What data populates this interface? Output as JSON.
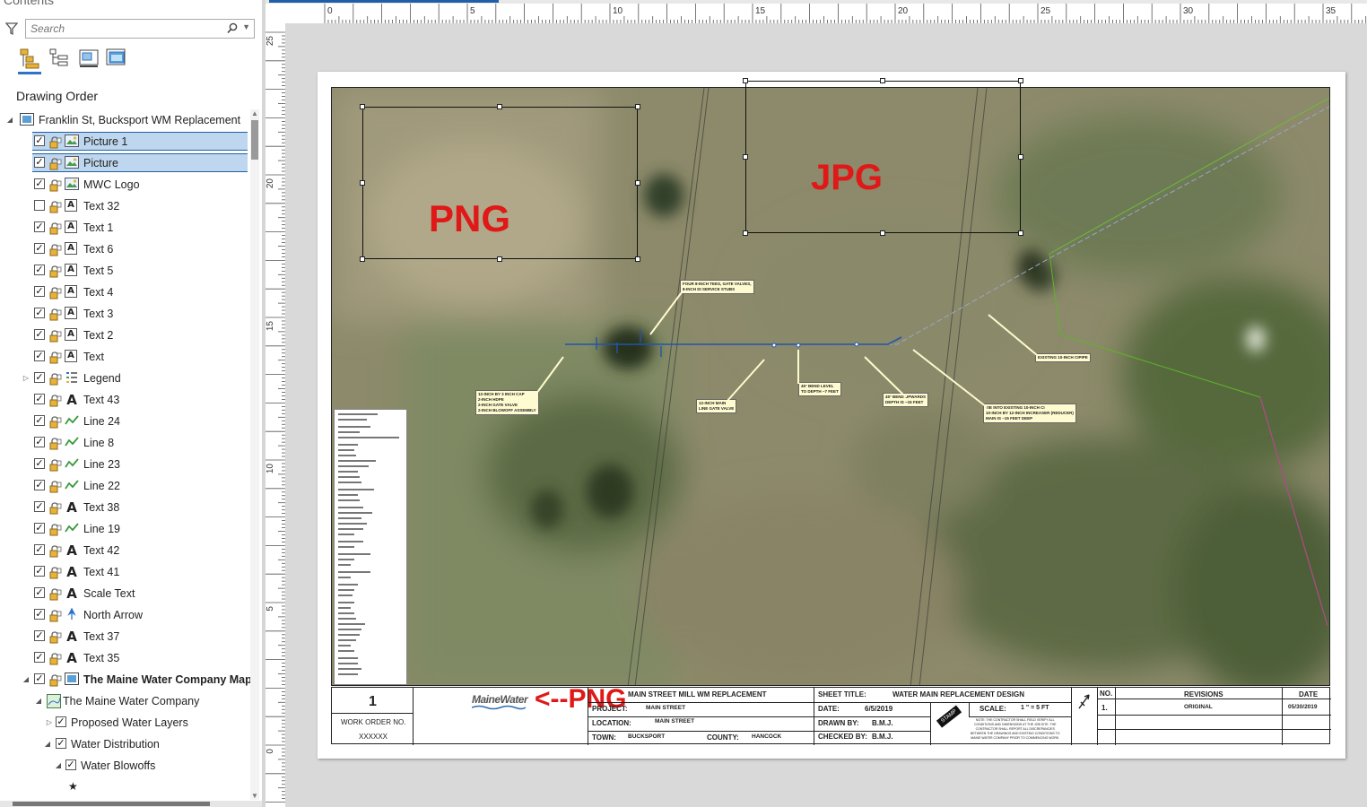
{
  "contents": {
    "pane_title": "Contents",
    "search_placeholder": "Search",
    "section_title": "Drawing Order",
    "map_name": "Franklin St, Bucksport WM Replacement",
    "items": [
      {
        "label": "Picture 1",
        "icon": "picture-icon",
        "checked": true
      },
      {
        "label": "Picture",
        "icon": "picture-icon",
        "checked": true
      },
      {
        "label": "MWC Logo",
        "icon": "picture-icon",
        "checked": true
      },
      {
        "label": "Text 32",
        "icon": "text-icon",
        "checked": false
      },
      {
        "label": "Text 1",
        "icon": "text-icon",
        "checked": true
      },
      {
        "label": "Text 6",
        "icon": "text-icon",
        "checked": true
      },
      {
        "label": "Text 5",
        "icon": "text-icon",
        "checked": true
      },
      {
        "label": "Text 4",
        "icon": "text-icon",
        "checked": true
      },
      {
        "label": "Text 3",
        "icon": "text-icon",
        "checked": true
      },
      {
        "label": "Text 2",
        "icon": "text-icon",
        "checked": true
      },
      {
        "label": "Text",
        "icon": "text-icon",
        "checked": true
      },
      {
        "label": "Legend",
        "icon": "legend-icon",
        "checked": true
      },
      {
        "label": "Text 43",
        "icon": "text-icon",
        "checked": true
      },
      {
        "label": "Line 24",
        "icon": "line-icon",
        "checked": true
      },
      {
        "label": "Line 8",
        "icon": "line-icon",
        "checked": true
      },
      {
        "label": "Line 23",
        "icon": "line-icon",
        "checked": true
      },
      {
        "label": "Line 22",
        "icon": "line-icon",
        "checked": true
      },
      {
        "label": "Text 38",
        "icon": "text-icon",
        "checked": true
      },
      {
        "label": "Line 19",
        "icon": "line-icon",
        "checked": true
      },
      {
        "label": "Text 42",
        "icon": "text-icon",
        "checked": true
      },
      {
        "label": "Text 41",
        "icon": "text-icon",
        "checked": true
      },
      {
        "label": "Scale Text",
        "icon": "text-icon",
        "checked": true
      },
      {
        "label": "North Arrow",
        "icon": "north-arrow-icon",
        "checked": true
      },
      {
        "label": "Text 37",
        "icon": "text-icon",
        "checked": true
      },
      {
        "label": "Text 35",
        "icon": "text-icon",
        "checked": true
      },
      {
        "label": "The Maine Water Company Map I",
        "icon": "map-frame-icon",
        "checked": true
      },
      {
        "label": "The Maine Water Company",
        "icon": "map-icon"
      },
      {
        "label": "Proposed Water Layers",
        "checked": true
      },
      {
        "label": "Water Distribution",
        "checked": true
      },
      {
        "label": "Water Blowoffs",
        "checked": true
      }
    ]
  },
  "ruler": {
    "h_labels": [
      "0",
      "5",
      "10",
      "15",
      "20",
      "25",
      "30",
      "35"
    ],
    "v_labels": [
      "25",
      "20",
      "15",
      "10",
      "5",
      "0"
    ]
  },
  "overlays": {
    "png_label": "PNG",
    "jpg_label": "JPG",
    "png_arrow_label": "<--PNG"
  },
  "annotations": {
    "a1": "FOUR 8-INCH TEES, GATE VALVES,\n8-INCH DI SERVICE STUBS",
    "a2": "12-INCH BY 3 INCH CAP\n2-INCH HDPE\n2-INCH GATE VALVE\n2-INCH BLOWOFF ASSEMBLY",
    "a3": "12-INCH MAIN\nLINE GATE VALVE",
    "a4": "45° BEND LEVEL\nTO DEPTH ~7 FEET",
    "a5": "45° BEND UPWARDS\nDEPTH IS ~15 FEET",
    "a6": "TIE INTO EXISTING 10-INCH CI\n10-INCH BY 12-INCH INCREASER (REDUCER)\nMAIN IS ~15 FEET DEEP",
    "a7": "EXISTING 10-INCH CIPIPE"
  },
  "title_block": {
    "sheet_no": "1",
    "work_order_label": "WORK ORDER NO.",
    "work_order_value": "XXXXXX",
    "logo_text": "MaineWater",
    "project_title": "MAIN STREET MILL WM REPLACEMENT",
    "project_label": "PROJECT:",
    "project_value": "MAIN STREET",
    "location_label": "LOCATION:",
    "location_value": "MAIN STREET",
    "town_label": "TOWN:",
    "town_value": "BUCKSPORT",
    "county_label": "COUNTY:",
    "county_value": "HANCOCK",
    "sheet_title_label": "SHEET TITLE:",
    "sheet_title_value": "WATER MAIN REPLACEMENT DESIGN",
    "date_label": "DATE:",
    "date_value": "6/5/2019",
    "scale_label": "SCALE:",
    "scale_value": "1 \" = 5 FT",
    "drawn_by_label": "DRAWN BY:",
    "drawn_by_value": "B.M.J.",
    "checked_by_label": "CHECKED BY:",
    "checked_by_value": "B.M.J.",
    "stamp": "STAMP",
    "note": "NOTE: THE CONTRACTOR SHALL FIELD VERIFY ALL\nCONDITIONS AND DIMENSIONS AT THE JOB SITE. THE\nCONTRACTOR SHALL REPORT ALL DISCREPANCIES\nBETWEEN THE DRAWINGS AND EXISTING CONDITIONS TO\nMAINE WATER COMPANY PRIOR TO COMMENCING WORK.",
    "rev_no_header": "NO.",
    "rev_header": "REVISIONS",
    "rev_date_header": "DATE",
    "rev_no": "1.",
    "rev_desc": "ORIGINAL",
    "rev_date": "05/30/2019"
  },
  "colors": {
    "accent": "#2d73c8",
    "selection": "#bfd7ee",
    "overlay_red": "#e01818"
  }
}
